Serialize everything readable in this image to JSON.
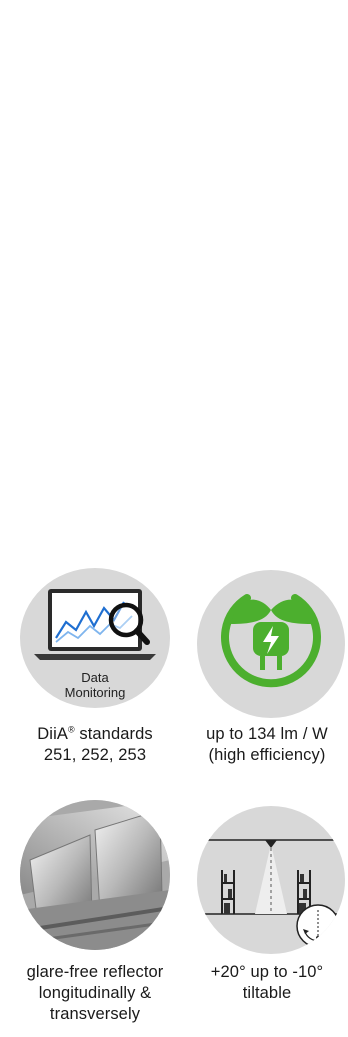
{
  "features": [
    {
      "id": "data-monitoring",
      "icon": "data-monitoring-icon",
      "icon_label": [
        "Data",
        "Monitoring"
      ],
      "caption_lines": [
        "DiiA",
        "®",
        " standards",
        "251, 252, 253"
      ]
    },
    {
      "id": "efficiency",
      "icon": "eco-plug-icon",
      "accent": "#4caf2e",
      "caption_lines": [
        "up to 134 lm / W",
        "(high efficiency)"
      ]
    },
    {
      "id": "reflector",
      "icon": "reflector-photo",
      "caption_lines": [
        "glare-free reflector",
        "longitudinally &",
        "transversely"
      ]
    },
    {
      "id": "tiltable",
      "icon": "tilt-aisle-icon",
      "caption_lines": [
        "+20° up to -10°",
        "tiltable"
      ]
    }
  ]
}
